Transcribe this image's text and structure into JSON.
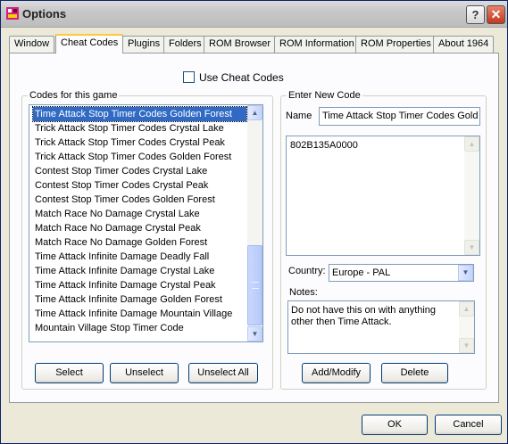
{
  "window": {
    "title": "Options",
    "help_glyph": "?",
    "close_glyph": "✕"
  },
  "tabs": [
    {
      "label": "Window"
    },
    {
      "label": "Cheat Codes"
    },
    {
      "label": "Plugins"
    },
    {
      "label": "Folders"
    },
    {
      "label": "ROM Browser"
    },
    {
      "label": "ROM Information"
    },
    {
      "label": "ROM Properties"
    },
    {
      "label": "About 1964"
    }
  ],
  "active_tab": "Cheat Codes",
  "use_cheat_codes": {
    "label": "Use Cheat Codes",
    "checked": false
  },
  "codes_group": {
    "label": "Codes for this game",
    "items": [
      "Time Attack Stop Timer Codes Golden Forest",
      "Trick Attack Stop Timer Codes Crystal Lake",
      "Trick Attack Stop Timer Codes Crystal Peak",
      "Trick Attack Stop Timer Codes Golden Forest",
      "Contest Stop Timer Codes Crystal Lake",
      "Contest Stop Timer Codes Crystal Peak",
      "Contest Stop Timer Codes Golden Forest",
      "Match Race No Damage Crystal Lake",
      "Match Race No Damage Crystal Peak",
      "Match Race No Damage Golden Forest",
      "Time Attack Infinite Damage Deadly Fall",
      "Time Attack Infinite Damage Crystal Lake",
      "Time Attack Infinite Damage Crystal Peak",
      "Time Attack Infinite Damage Golden Forest",
      "Time Attack Infinite Damage Mountain Village",
      "Mountain Village Stop Timer Code"
    ],
    "selected_index": 0,
    "select_label": "Select",
    "unselect_label": "Unselect",
    "unselect_all_label": "Unselect All"
  },
  "new_code_group": {
    "label": "Enter New Code",
    "name_label": "Name",
    "name_value": "Time Attack Stop Timer Codes Gold",
    "code_value": "802B135A0000",
    "country_label": "Country:",
    "country_value": "Europe - PAL",
    "notes_label": "Notes:",
    "notes_value": "Do not have this on with anything other then Time Attack.",
    "add_modify_label": "Add/Modify",
    "delete_label": "Delete"
  },
  "footer": {
    "ok_label": "OK",
    "cancel_label": "Cancel"
  },
  "colors": {
    "selection": "#316ac5",
    "tab_highlight": "#ffc83c",
    "dialog_bg": "#ece9d8"
  }
}
